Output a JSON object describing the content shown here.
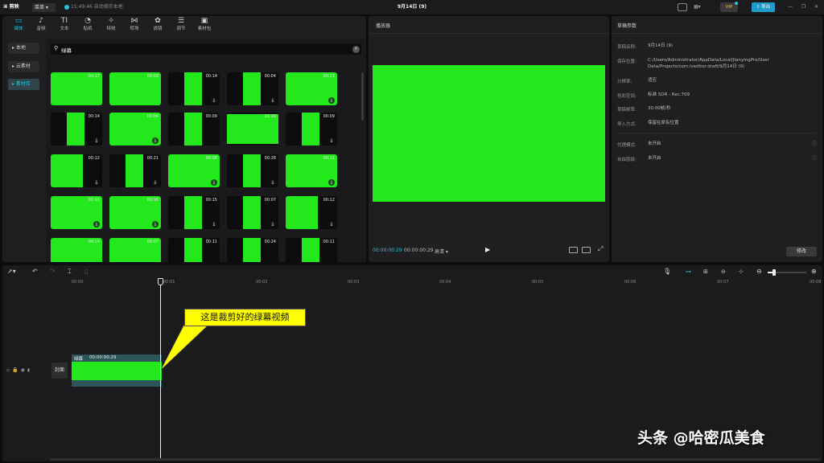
{
  "app": {
    "name": "剪映",
    "menu_label": "菜单",
    "autosave": "15:49:46 自动保存本地",
    "project_title": "9月14日 (9)",
    "vip": "VIP",
    "export_label": "导出"
  },
  "toolbar": [
    {
      "icon": "媒",
      "label": "媒体"
    },
    {
      "icon": "♪",
      "label": "音频"
    },
    {
      "icon": "TI",
      "label": "文本"
    },
    {
      "icon": "◔",
      "label": "贴纸"
    },
    {
      "icon": "✧",
      "label": "特效"
    },
    {
      "icon": "⋈",
      "label": "转场"
    },
    {
      "icon": "✿",
      "label": "滤镜"
    },
    {
      "icon": "☰",
      "label": "调节"
    },
    {
      "icon": "▣",
      "label": "素材包"
    }
  ],
  "sidebar": {
    "items": [
      "本地",
      "云素材",
      "素材库"
    ]
  },
  "search": {
    "value": "绿幕"
  },
  "library": {
    "durations": [
      "00:17",
      "00:09",
      "00:14",
      "00:04",
      "00:13",
      "00:14",
      "00:04",
      "00:09",
      "01:20",
      "00:09",
      "00:12",
      "00:21",
      "00:08",
      "00:28",
      "00:11",
      "00:10",
      "00:16",
      "00:15",
      "00:07",
      "00:12",
      "00:14",
      "00:07",
      "00:11",
      "00:24",
      "00:11"
    ]
  },
  "player": {
    "title": "播放器",
    "current_time": "00:00:00:29",
    "total_time": "00:00:00:29",
    "quality": "高清"
  },
  "draft": {
    "title": "草稿参数",
    "params": [
      {
        "label": "草稿名称:",
        "value": "9月14日 (9)"
      },
      {
        "label": "保存位置:",
        "value": "C:/Users/Administrator/AppData/Local/JianyingPro/User Data/Projects/com.lveditor.draft/9月14日 (9)"
      },
      {
        "label": "分辨率:",
        "value": "适应"
      },
      {
        "label": "色彩空间:",
        "value": "标准 SDR - Rec.709"
      },
      {
        "label": "草稿帧率:",
        "value": "30.00帧/秒"
      },
      {
        "label": "导入方式:",
        "value": "保留在原有位置"
      },
      {
        "label": "代理模式:",
        "value": "未开启"
      },
      {
        "label": "自由层级:",
        "value": "未开启"
      }
    ],
    "modify_label": "修改"
  },
  "timeline": {
    "ruler": [
      "00:00",
      "00:01",
      "00:02",
      "00:03",
      "00:04",
      "00:05",
      "00:06",
      "00:07",
      "00:08"
    ],
    "track_label": "封面",
    "clip_name": "绿幕",
    "clip_duration": "00:00:00:29"
  },
  "annotation": {
    "text": "这是裁剪好的绿幕视频"
  },
  "watermark": {
    "text": "头条 @哈密瓜美食"
  },
  "colors": {
    "green_screen": "#22e81c",
    "accent": "#1ec6d9",
    "export_btn": "#1e9cc9",
    "annotation_bg": "#ffff00"
  }
}
